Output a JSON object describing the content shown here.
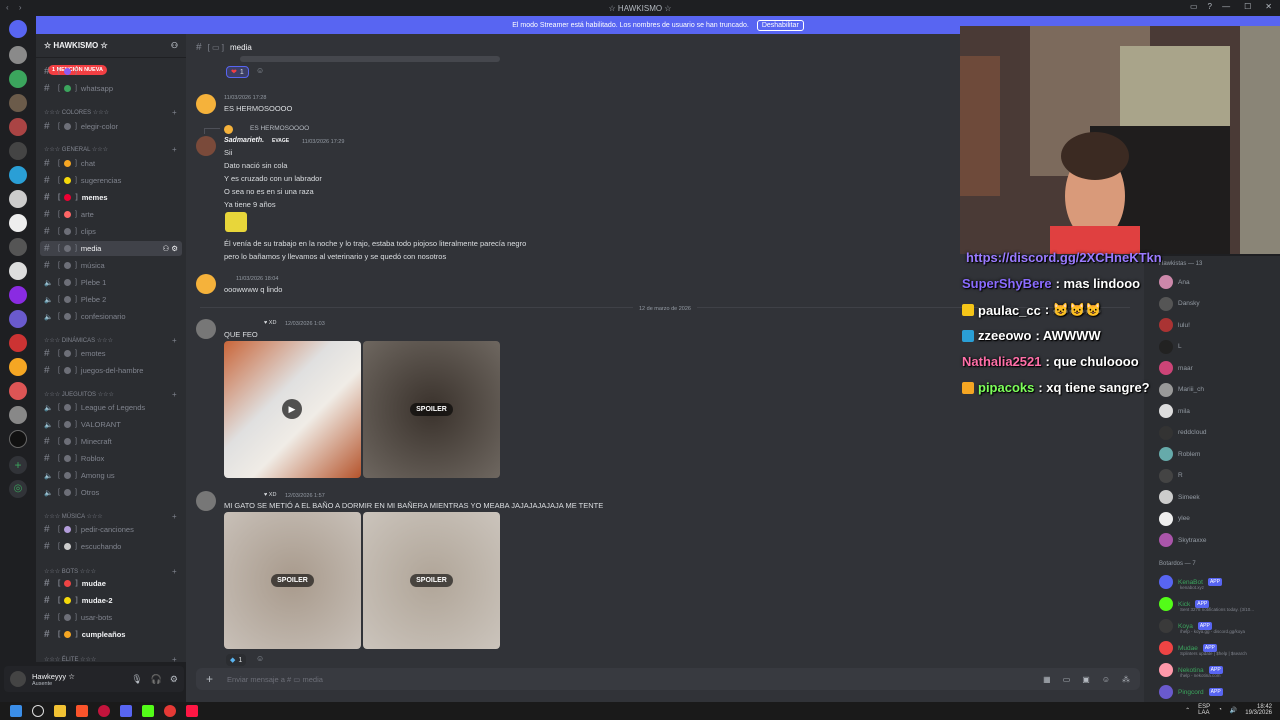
{
  "window": {
    "title": "☆ HAWKISMO ☆"
  },
  "banner": {
    "text": "El modo Streamer está habilitado. Los nombres de usuario se han truncado.",
    "button": "Deshabilitar"
  },
  "server": {
    "name": "☆ HAWKISMO ☆"
  },
  "sidebar": {
    "mention_badge": "1 MENCIÓN NUEVA",
    "categories": [
      "☆☆☆ COLORES ☆☆☆",
      "☆☆☆ GENERAL ☆☆☆",
      "☆☆☆ DINÁMICAS ☆☆☆",
      "☆☆☆ JUEGUITOS ☆☆☆",
      "☆☆☆ MÚSICA ☆☆☆",
      "☆☆☆ BOTS ☆☆☆",
      "☆☆☆ ÉLITE ☆☆☆"
    ],
    "channels": [
      {
        "name": "",
        "icon": "hash"
      },
      {
        "name": "whatsapp",
        "icon": "hash"
      },
      {
        "name": "elegir-color",
        "icon": "hash"
      },
      {
        "name": "chat",
        "icon": "hash"
      },
      {
        "name": "sugerencias",
        "icon": "hash"
      },
      {
        "name": "memes",
        "icon": "hash"
      },
      {
        "name": "arte",
        "icon": "hash"
      },
      {
        "name": "clips",
        "icon": "hash"
      },
      {
        "name": "media",
        "icon": "hash"
      },
      {
        "name": "música",
        "icon": "hash"
      },
      {
        "name": "Plebe 1",
        "icon": "speaker"
      },
      {
        "name": "Plebe 2",
        "icon": "speaker"
      },
      {
        "name": "confesionario",
        "icon": "speaker"
      },
      {
        "name": "emotes",
        "icon": "hash"
      },
      {
        "name": "juegos-del-hambre",
        "icon": "hash"
      },
      {
        "name": "League of Legends",
        "icon": "speaker"
      },
      {
        "name": "VALORANT",
        "icon": "speaker"
      },
      {
        "name": "Minecraft",
        "icon": "hash"
      },
      {
        "name": "Roblox",
        "icon": "hash"
      },
      {
        "name": "Among us",
        "icon": "speaker"
      },
      {
        "name": "Otros",
        "icon": "speaker"
      },
      {
        "name": "pedir-canciones",
        "icon": "hash"
      },
      {
        "name": "escuchando",
        "icon": "hash"
      },
      {
        "name": "mudae",
        "icon": "hash"
      },
      {
        "name": "mudae-2",
        "icon": "hash"
      },
      {
        "name": "usar-bots",
        "icon": "hash"
      },
      {
        "name": "cumpleaños",
        "icon": "hash"
      }
    ]
  },
  "user": {
    "name": "Hawkeyyy ☆",
    "status": "Ausente"
  },
  "channel_header": {
    "name": "media"
  },
  "messages": {
    "m1": {
      "reaction_count": "1"
    },
    "m2": {
      "time": "11/03/2026 17:28",
      "text": "ES HERMOSOOOO"
    },
    "m3": {
      "reply_text": "ES HERMOSOOOO",
      "author": "Sadmarieth.",
      "tag": "EVAGE",
      "time": "11/03/2026 17:29",
      "lines": [
        "Sii",
        "Dato nació sin cola",
        "Y es cruzado con un labrador",
        "O sea no es en si una raza",
        "Ya tiene 9 años",
        "Él venía de su trabajo en la noche y lo trajo, estaba todo piojoso literalmente parecía negro",
        "pero lo bañamos y llevamos al veterinario y se quedó con nosotros"
      ]
    },
    "m4": {
      "time": "11/03/2026 18:04",
      "text": "ooowwww q lindo"
    },
    "date_divider": "12 de marzo de 2026",
    "m5": {
      "tag": "XD",
      "time": "12/03/2026 1:03",
      "text": "QUE FEO",
      "spoiler": "SPOILER"
    },
    "m6": {
      "tag": "XD",
      "time": "12/03/2026 1:57",
      "text": "MI GATO SE METIÓ A EL BAÑO A DORMIR EN MI BAÑERA MIENTRAS YO MEABA JAJAJAJAJAJA ME TENTE",
      "spoiler": "SPOILER",
      "reaction_count": "1"
    }
  },
  "composer": {
    "placeholder": "Enviar mensaje a #",
    "channel": "media"
  },
  "members": {
    "group1": "Hawkistas — 13",
    "group1_items": [
      "Ana",
      "Dansky",
      "lulu!",
      "L",
      "maar",
      "Mariii_ch",
      "mila",
      "reddcloud",
      "Roblem",
      "R",
      "Simeek",
      "ylee",
      "Skytraxxe"
    ],
    "group2": "Botardos — 7",
    "group2_items": [
      {
        "name": "KenaBot",
        "sub": "kenabot.xyz"
      },
      {
        "name": "Kick",
        "sub": "Sent 3278 notifications today. (3/10..."
      },
      {
        "name": "Koya",
        "sub": "/help - koya.gg - discord.gg/koya"
      },
      {
        "name": "Mudae",
        "sub": "Splinters update | $help | $search"
      },
      {
        "name": "Nekotina",
        "sub": "/help - nekotina.com"
      },
      {
        "name": "Pingcord",
        "sub": ""
      }
    ],
    "app_label": "APP"
  },
  "overlay_chat": [
    {
      "user": "",
      "text": "https://discord.gg/2XCHneKTkn",
      "color": "#9b7bff"
    },
    {
      "user": "SuperShyBere",
      "text": ": mas lindooo",
      "color": "#8a6cff"
    },
    {
      "user": "paulac_cc",
      "text": ": 😺😺😺",
      "color": "#ffffff"
    },
    {
      "user": "zzeeowo",
      "text": ": AWWWW",
      "color": "#ffffff"
    },
    {
      "user": "Nathalia2521",
      "text": ": que chuloooo",
      "color": "#ff6fa8"
    },
    {
      "user": "pipacoks",
      "text": ": xq tiene sangre?",
      "color": "#7dff5a"
    }
  ],
  "taskbar": {
    "lang": "ESP",
    "lang2": "LAA",
    "time": "18:42",
    "date": "19/3/2026"
  },
  "colors": {
    "accent": "#5865f2",
    "bg": "#313338",
    "sidebar": "#2b2d31",
    "mention": "#f23f43"
  }
}
